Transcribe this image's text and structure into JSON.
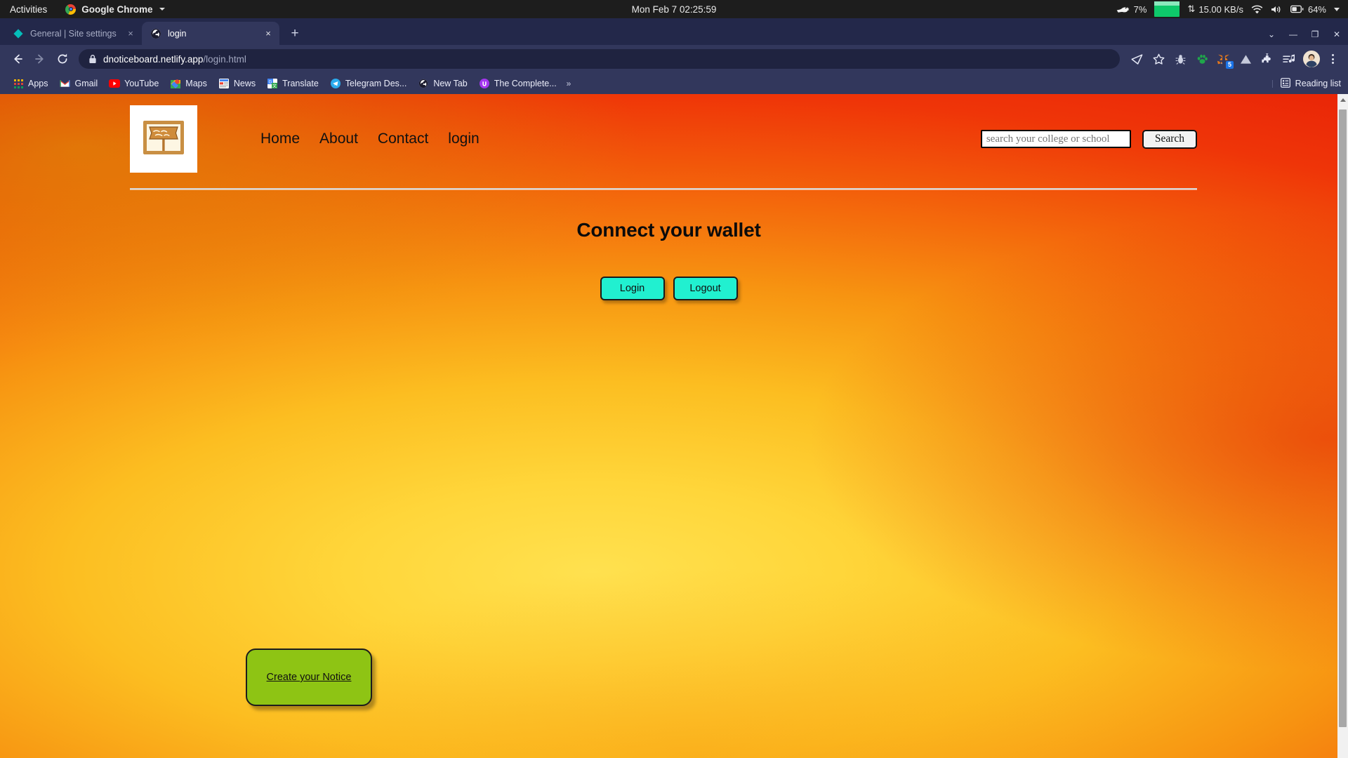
{
  "os_bar": {
    "activities": "Activities",
    "app_name": "Google Chrome",
    "clock": "Mon Feb 7  02:25:59",
    "cpu_percent": "7%",
    "network_speed": "15.00 KB/s",
    "battery_percent": "64%",
    "icons": {
      "chrome": "chrome-icon",
      "app_menu_caret": "chevron-down-icon",
      "cpu": "mouse-cpu-icon",
      "memory": "memory-bar-icon",
      "network": "network-updown-icon",
      "wifi": "wifi-icon",
      "volume": "volume-icon",
      "battery": "battery-icon",
      "system_menu": "chevron-down-icon"
    }
  },
  "browser": {
    "tabs": [
      {
        "title": "General | Site settings",
        "favicon": "netlify-diamond-icon",
        "active": false,
        "close": "×"
      },
      {
        "title": "login",
        "favicon": "globe-icon",
        "active": true,
        "close": "×"
      }
    ],
    "new_tab_label": "+",
    "window_controls": {
      "minimize": "—",
      "maximize": "❐",
      "close": "✕",
      "overflow": "⌄"
    },
    "nav": {
      "back": "back-arrow-icon",
      "forward": "forward-arrow-icon",
      "reload": "reload-icon"
    },
    "omnibox": {
      "lock": "lock-icon",
      "domain": "dnoticeboard.netlify.app",
      "path": "/login.html"
    },
    "toolbar_icons": [
      {
        "name": "share-send-icon",
        "glyph": "➤"
      },
      {
        "name": "bookmark-star-icon",
        "glyph": "☆"
      },
      {
        "name": "bug-extension-icon",
        "glyph": "🐞"
      },
      {
        "name": "paw-extension-icon",
        "glyph": "🐾"
      },
      {
        "name": "metamask-fox-icon",
        "glyph": "🦊",
        "badge": "5"
      },
      {
        "name": "mountain-extension-icon",
        "glyph": "⛰"
      },
      {
        "name": "puzzle-extensions-icon",
        "glyph": "🧩"
      },
      {
        "name": "reading-list-music-icon",
        "glyph": "☰"
      }
    ],
    "profile_avatar": "user-avatar",
    "menu": "kebab-menu-icon",
    "bookmarks": [
      {
        "label": "Apps",
        "icon": "apps-grid-icon"
      },
      {
        "label": "Gmail",
        "icon": "gmail-icon"
      },
      {
        "label": "YouTube",
        "icon": "youtube-icon"
      },
      {
        "label": "Maps",
        "icon": "maps-icon"
      },
      {
        "label": "News",
        "icon": "news-icon"
      },
      {
        "label": "Translate",
        "icon": "translate-icon"
      },
      {
        "label": "Telegram Des...",
        "icon": "telegram-icon"
      },
      {
        "label": "New Tab",
        "icon": "globe-icon"
      },
      {
        "label": "The Complete...",
        "icon": "udemy-icon"
      }
    ],
    "bookmarks_overflow": "»",
    "reading_list": {
      "label": "Reading list",
      "icon": "reading-list-icon"
    }
  },
  "site": {
    "logo_alt": "notice-board-logo",
    "nav_links": [
      {
        "label": "Home"
      },
      {
        "label": "About"
      },
      {
        "label": "Contact"
      },
      {
        "label": "login"
      }
    ],
    "search": {
      "placeholder": "search your college or school",
      "value": "",
      "button_label": "Search"
    },
    "main": {
      "heading": "Connect your wallet",
      "login_label": "Login",
      "logout_label": "Logout",
      "create_notice_label": "Create your Notice"
    }
  },
  "colors": {
    "gnome_bar": "#1d1d1d",
    "chrome_frame": "#23284a",
    "chrome_toolbar": "#32375c",
    "omnibox": "#1f2340",
    "wallet_button": "#21f0d0",
    "notice_card": "#8ec414",
    "page_gradient_from": "#ffe14f",
    "page_gradient_to": "#e01c06"
  }
}
